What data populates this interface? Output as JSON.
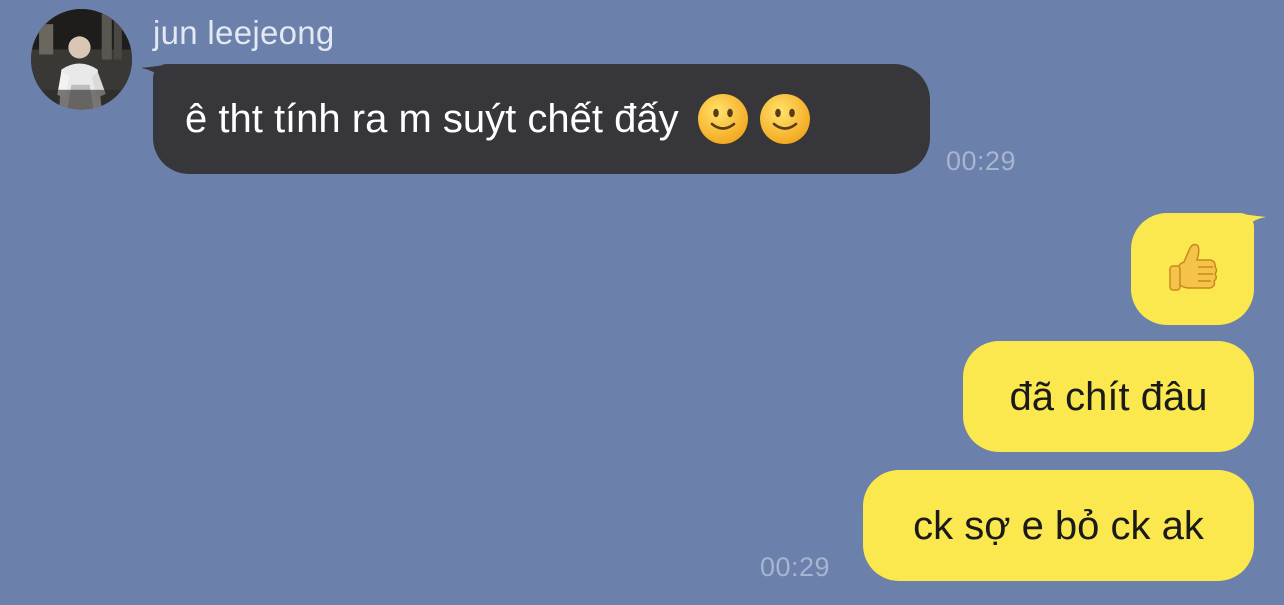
{
  "chat": {
    "background": "#6b80aa",
    "incoming_bubble_color": "#37373b",
    "outgoing_bubble_color": "#fbe74e"
  },
  "sender": {
    "name": "jun leejeong",
    "avatar_icon": "profile-photo"
  },
  "messages": [
    {
      "direction": "incoming",
      "text": "ê tht tính ra m suýt chết đấy",
      "emojis": [
        "slightly-smiling-face",
        "slightly-smiling-face"
      ],
      "time": "00:29"
    },
    {
      "direction": "outgoing",
      "emoji": "thumbs-up"
    },
    {
      "direction": "outgoing",
      "text": "đã chít đâu"
    },
    {
      "direction": "outgoing",
      "text": "ck sợ e bỏ ck ak",
      "time": "00:29"
    }
  ]
}
